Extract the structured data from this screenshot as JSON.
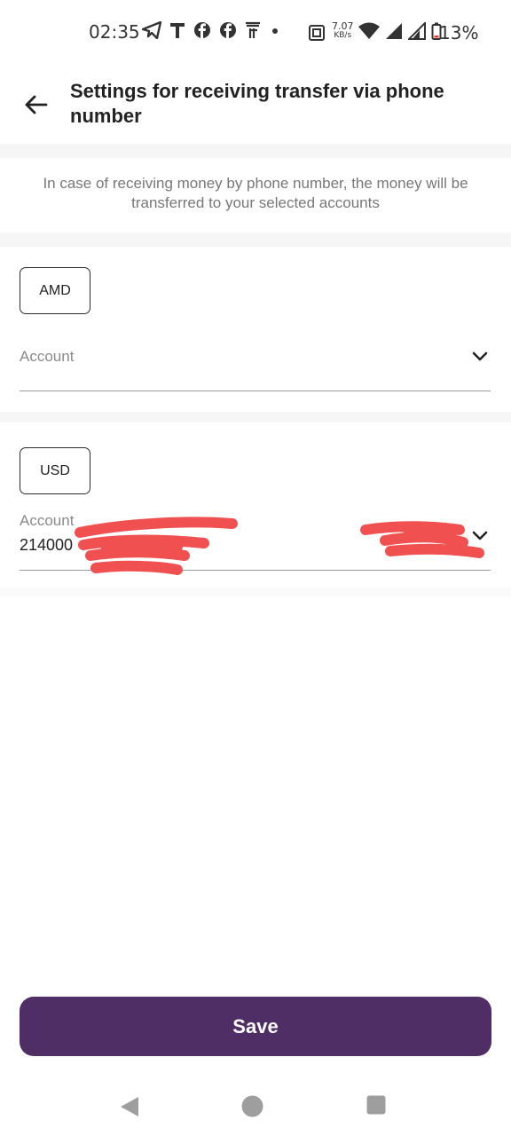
{
  "status_bar": {
    "time": "02:35",
    "speed_value": "7.07",
    "speed_unit": "KB/s",
    "battery": "13%",
    "icons": [
      "telegram-icon",
      "t-app-icon",
      "facebook-icon",
      "facebook-icon",
      "app-icon",
      "dot-icon",
      "nfc-icon",
      "wifi-icon",
      "signal-icon",
      "signal-r-icon",
      "battery-icon"
    ]
  },
  "header": {
    "title": "Settings for receiving transfer via phone number",
    "back_icon": "arrow-left-icon"
  },
  "info": {
    "text": "In case of receiving money by phone number, the money will be transferred to your selected accounts"
  },
  "accounts": [
    {
      "currency": "AMD",
      "label": "Account",
      "value": ""
    },
    {
      "currency": "USD",
      "label": "Account",
      "value": "214000"
    }
  ],
  "save_label": "Save",
  "colors": {
    "primary": "#4f2d65",
    "redaction": "#f05050"
  }
}
